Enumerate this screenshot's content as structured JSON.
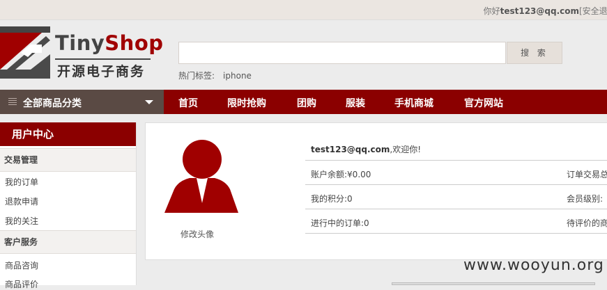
{
  "topbar": {
    "greeting_prefix": "你好",
    "username": "test123@qq.com",
    "logout": "[安全退出]"
  },
  "brand": {
    "name_part1": "Tiny",
    "name_part2": "Shop",
    "subtitle": "开源电子商务"
  },
  "search": {
    "placeholder": "",
    "button": "搜 索",
    "hot_label": "热门标签:",
    "hot_tags": [
      "iphone"
    ]
  },
  "nav": {
    "all_categories": "全部商品分类",
    "items": [
      "首页",
      "限时抢购",
      "团购",
      "服装",
      "手机商城",
      "官方网站"
    ]
  },
  "sidebar": {
    "title": "用户中心",
    "sections": [
      {
        "title": "交易管理",
        "links": [
          "我的订单",
          "退款申请",
          "我的关注"
        ]
      },
      {
        "title": "客户服务",
        "links": [
          "商品咨询",
          "商品评价"
        ]
      }
    ]
  },
  "profile": {
    "edit_avatar": "修改头像",
    "welcome_user": "test123@qq.com",
    "welcome_text": ",欢迎你!",
    "balance_label": "账户余额:",
    "balance_value": "¥0.00",
    "points_label": "我的积分:",
    "points_value": "0",
    "orders_label": "进行中的订单:",
    "orders_value": "0",
    "right_col": [
      "订单交易总",
      "会员级别:",
      "待评价的商"
    ]
  },
  "watermark": "www.wooyun.org",
  "colors": {
    "brand_red": "#8b0000",
    "category_bg": "#5a4a44",
    "avatar_red": "#a00000"
  }
}
